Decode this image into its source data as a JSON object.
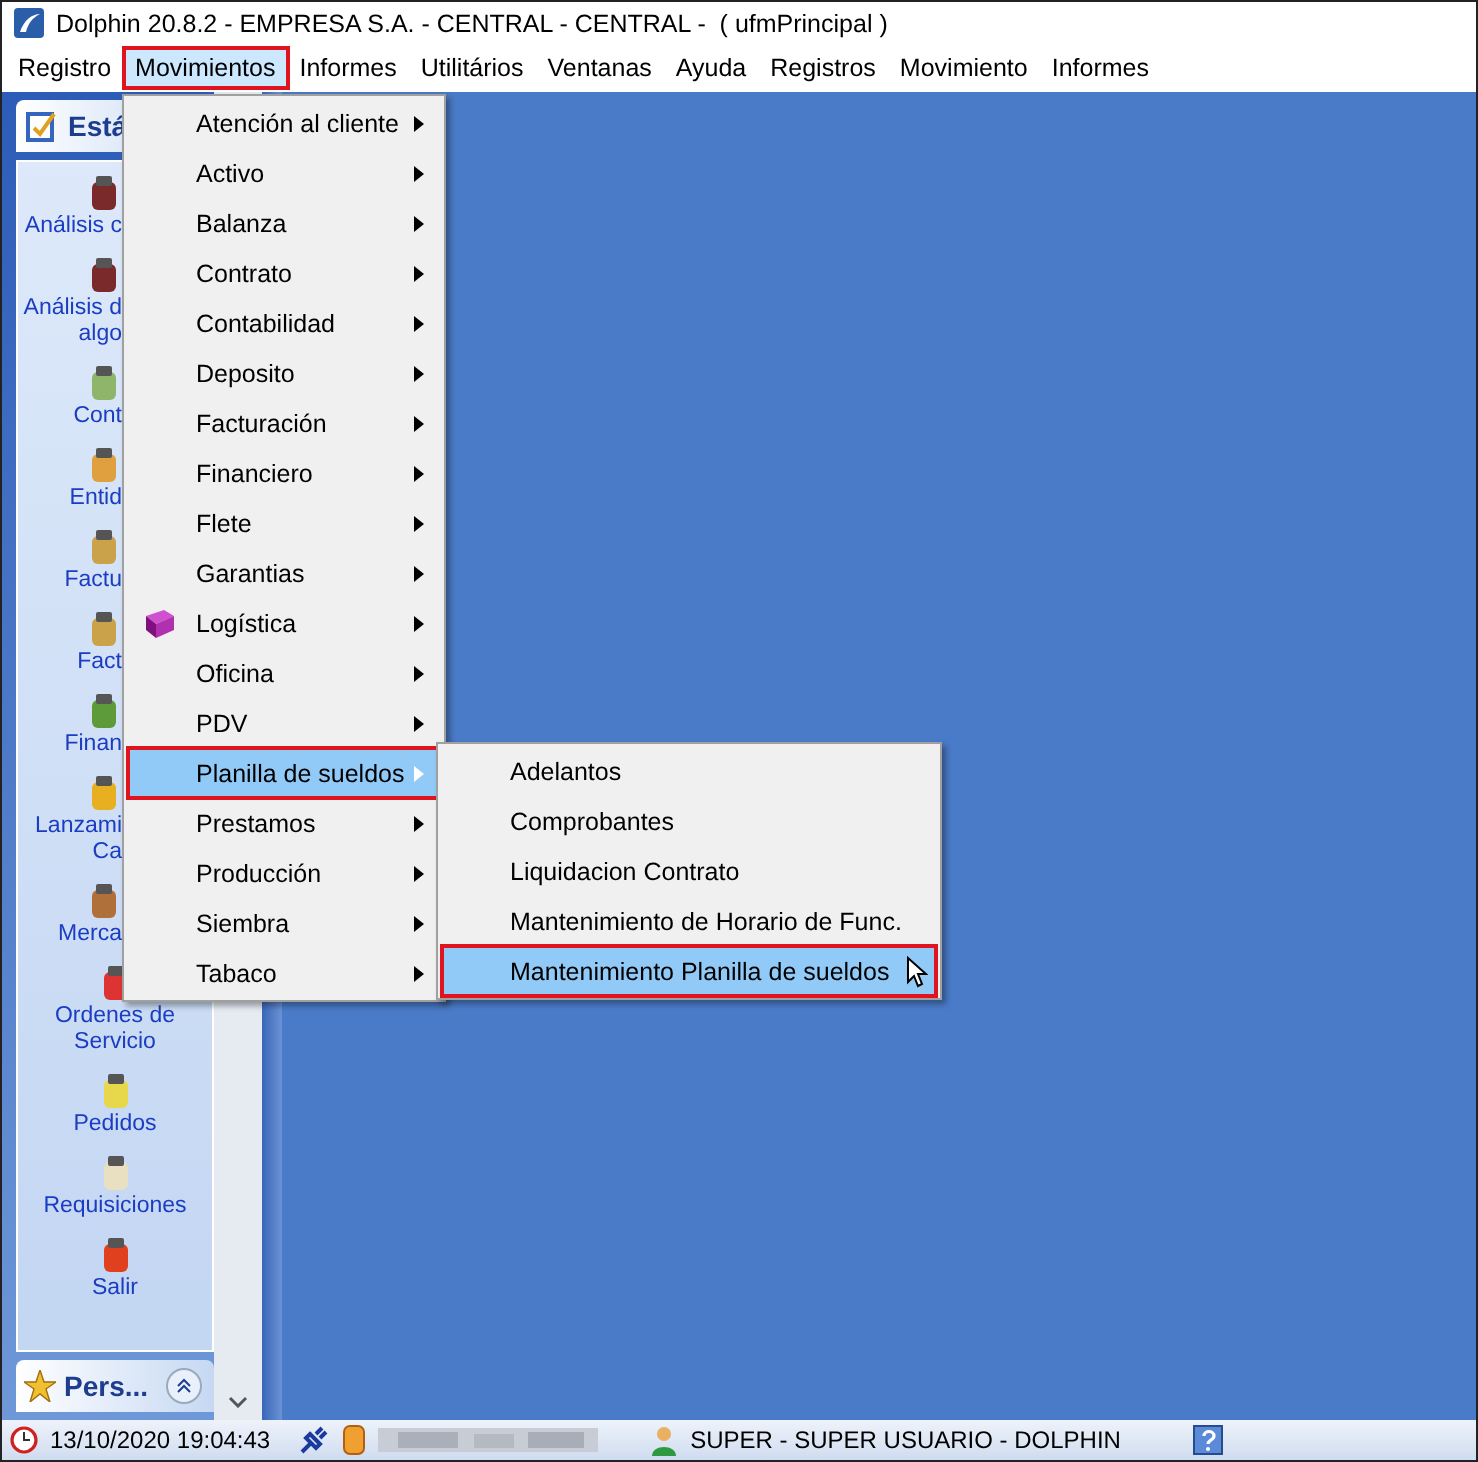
{
  "window": {
    "title": "Dolphin 20.8.2 - EMPRESA S.A. - CENTRAL - CENTRAL -  ( ufmPrincipal )"
  },
  "menubar": [
    {
      "label": "Registro",
      "selected": false,
      "outlined": false
    },
    {
      "label": "Movimientos",
      "selected": true,
      "outlined": true
    },
    {
      "label": "Informes",
      "selected": false,
      "outlined": false
    },
    {
      "label": "Utilitários",
      "selected": false,
      "outlined": false
    },
    {
      "label": "Ventanas",
      "selected": false,
      "outlined": false
    },
    {
      "label": "Ayuda",
      "selected": false,
      "outlined": false
    },
    {
      "label": "Registros",
      "selected": false,
      "outlined": false
    },
    {
      "label": "Movimiento",
      "selected": false,
      "outlined": false
    },
    {
      "label": "Informes",
      "selected": false,
      "outlined": false
    }
  ],
  "sidebar": {
    "header": "Está",
    "items": [
      {
        "lines": [
          "Análisis c"
        ]
      },
      {
        "lines": [
          "Análisis d",
          "algo"
        ]
      },
      {
        "lines": [
          "Cont"
        ]
      },
      {
        "lines": [
          "Entid"
        ]
      },
      {
        "lines": [
          "Factu"
        ]
      },
      {
        "lines": [
          "Fact"
        ]
      },
      {
        "lines": [
          "Finan"
        ]
      },
      {
        "lines": [
          "Lanzami",
          "Ca"
        ]
      },
      {
        "lines": [
          "Merca"
        ]
      },
      {
        "lines": [
          "Ordenes de",
          "Servicio"
        ]
      },
      {
        "lines": [
          "Pedidos"
        ]
      },
      {
        "lines": [
          "Requisiciones"
        ]
      },
      {
        "lines": [
          "Salir"
        ]
      }
    ],
    "footer": "Pers..."
  },
  "menu": [
    {
      "label": "Atención al cliente",
      "selected": false,
      "outlined": false
    },
    {
      "label": "Activo",
      "selected": false,
      "outlined": false
    },
    {
      "label": "Balanza",
      "selected": false,
      "outlined": false
    },
    {
      "label": "Contrato",
      "selected": false,
      "outlined": false
    },
    {
      "label": "Contabilidad",
      "selected": false,
      "outlined": false
    },
    {
      "label": "Deposito",
      "selected": false,
      "outlined": false
    },
    {
      "label": "Facturación",
      "selected": false,
      "outlined": false
    },
    {
      "label": "Financiero",
      "selected": false,
      "outlined": false
    },
    {
      "label": "Flete",
      "selected": false,
      "outlined": false
    },
    {
      "label": "Garantias",
      "selected": false,
      "outlined": false
    },
    {
      "label": "Logística",
      "selected": false,
      "outlined": false,
      "icon": true
    },
    {
      "label": "Oficina",
      "selected": false,
      "outlined": false
    },
    {
      "label": "PDV",
      "selected": false,
      "outlined": false
    },
    {
      "label": "Planilla de sueldos",
      "selected": true,
      "outlined": true
    },
    {
      "label": "Prestamos",
      "selected": false,
      "outlined": false
    },
    {
      "label": "Producción",
      "selected": false,
      "outlined": false
    },
    {
      "label": "Siembra",
      "selected": false,
      "outlined": false
    },
    {
      "label": "Tabaco",
      "selected": false,
      "outlined": false
    }
  ],
  "submenu": [
    {
      "label": "Adelantos",
      "selected": false,
      "outlined": false
    },
    {
      "label": "Comprobantes",
      "selected": false,
      "outlined": false
    },
    {
      "label": "Liquidacion Contrato",
      "selected": false,
      "outlined": false
    },
    {
      "label": "Mantenimiento de Horario de Func.",
      "selected": false,
      "outlined": false
    },
    {
      "label": "Mantenimiento Planilla de sueldos",
      "selected": true,
      "outlined": true
    }
  ],
  "status_bar": {
    "datetime": "13/10/2020 19:04:43",
    "user": "SUPER - SUPER USUARIO - DOLPHIN"
  }
}
